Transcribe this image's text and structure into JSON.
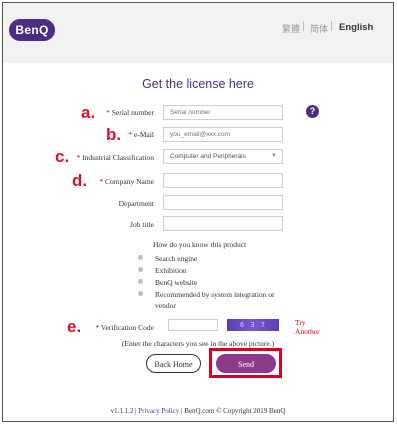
{
  "header": {
    "logo_text": "BenQ",
    "languages": [
      "繁體",
      "简体",
      "English"
    ],
    "active_language": "English"
  },
  "page": {
    "title": "Get the license here"
  },
  "form": {
    "serial_number": {
      "marker": "a.",
      "label": "Serial number",
      "required": true,
      "placeholder": "Serial number",
      "value": ""
    },
    "email": {
      "marker": "b.",
      "label": "e-Mail",
      "required": true,
      "placeholder": "you_email@xxx.com",
      "value": ""
    },
    "industrial_classification": {
      "marker": "c.",
      "label": "Industrial Classification",
      "required": true,
      "selected": "Computer and Peripherals"
    },
    "company_name": {
      "marker": "d.",
      "label": "Company Name",
      "required": true,
      "value": ""
    },
    "department": {
      "label": "Department",
      "value": ""
    },
    "job_title": {
      "label": "Job title",
      "value": ""
    },
    "how_known": {
      "question": "How do you know this product",
      "options": [
        "Search engine",
        "Exhibition",
        "BenQ website",
        "Recommended by system integration or vendor"
      ]
    },
    "verification": {
      "marker": "e.",
      "label": "Verification Code",
      "required": true,
      "value": "",
      "captcha_text": "6 3 7",
      "try_another": "Try Another",
      "hint": "(Enter the characters you see in the above picture.)"
    },
    "buttons": {
      "back_home": "Back Home",
      "send": "Send"
    }
  },
  "footer": {
    "version": "v1.1.1.2",
    "privacy_link": "Privacy Policy",
    "site_link": "BenQ.com",
    "copyright": "© Copyright 2019 BenQ"
  },
  "colors": {
    "brand": "#4b2e83",
    "send_button": "#8e3a8a",
    "marker": "#e0102a",
    "required_star": "#cc0000",
    "highlight": "#e3001b"
  }
}
